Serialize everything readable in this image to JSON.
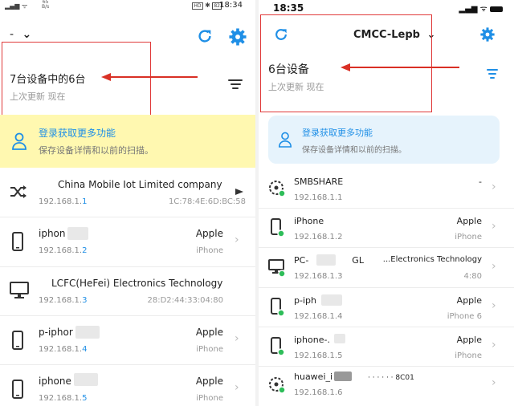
{
  "left": {
    "status": {
      "net_value": "65",
      "net_unit": "B/s",
      "time": "18:34",
      "battery": "82",
      "hd_label": "HD"
    },
    "header": {
      "title": "-",
      "chevron": "⌄"
    },
    "summary": {
      "count_text": "7台设备中的6台",
      "last_update": "上次更新 现在"
    },
    "banner": {
      "title": "登录获取更多功能",
      "subtitle": "保存设备详情和以前的扫描。",
      "bg": "#fff8b0"
    },
    "devices": [
      {
        "name": "China Mobile Iot Limited company",
        "ip_prefix": "192.168.1.",
        "ip_last": "1",
        "vendor": "",
        "type": "",
        "mac": "1C:78:4E:6D:BC:58",
        "icon": "shuffle-icon"
      },
      {
        "name": "iphon",
        "ip_prefix": "192.168.1.",
        "ip_last": "2",
        "vendor": "Apple",
        "type": "iPhone",
        "mac": "",
        "icon": "phone-icon"
      },
      {
        "name": "LCFC(HeFei) Electronics Technology",
        "ip_prefix": "192.168.1.",
        "ip_last": "3",
        "vendor": "",
        "type": "",
        "mac": "28:D2:44:33:04:80",
        "icon": "monitor-icon"
      },
      {
        "name": "p-iphor",
        "ip_prefix": "192.168.1.",
        "ip_last": "4",
        "vendor": "Apple",
        "type": "iPhone",
        "mac": "",
        "icon": "phone-icon"
      },
      {
        "name": "iphone",
        "ip_prefix": "192.168.1.",
        "ip_last": "5",
        "vendor": "Apple",
        "type": "iPhone",
        "mac": "",
        "icon": "phone-icon"
      }
    ]
  },
  "right": {
    "status": {
      "time": "18:35"
    },
    "header": {
      "title": "CMCC-Lepb",
      "chevron": "⌄"
    },
    "summary": {
      "count_text": "6台设备",
      "last_update": "上次更新 现在"
    },
    "banner": {
      "title": "登录获取更多功能",
      "subtitle": "保存设备详情和以前的扫描。",
      "bg": "#e6f3fc"
    },
    "devices": [
      {
        "name": "SMBSHARE",
        "ip": "192.168.1.1",
        "vendor": "-",
        "type": "",
        "icon": "router-icon"
      },
      {
        "name": "iPhone",
        "ip": "192.168.1.2",
        "vendor": "Apple",
        "type": "iPhone",
        "icon": "phone-icon"
      },
      {
        "name": "PC-",
        "name_extra": "GL",
        "ip": "192.168.1.3",
        "vendor": "...Electronics Technology",
        "type": "4:80",
        "icon": "monitor-icon"
      },
      {
        "name": "p-iph",
        "ip": "192.168.1.4",
        "vendor": "Apple",
        "type": "iPhone 6",
        "icon": "phone-icon"
      },
      {
        "name": "iphone-.",
        "ip": "192.168.1.5",
        "vendor": "Apple",
        "type": "iPhone",
        "icon": "phone-icon"
      },
      {
        "name": "huawei_i",
        "name_extra": "‧ ‧ ‧ ‧ ‧ ‧ 8C01",
        "ip": "192.168.1.6",
        "vendor": "",
        "type": "",
        "icon": "router-icon"
      }
    ]
  },
  "colors": {
    "accent": "#1f8fe6",
    "online": "#2ebd59",
    "annotation": "#d93025"
  }
}
